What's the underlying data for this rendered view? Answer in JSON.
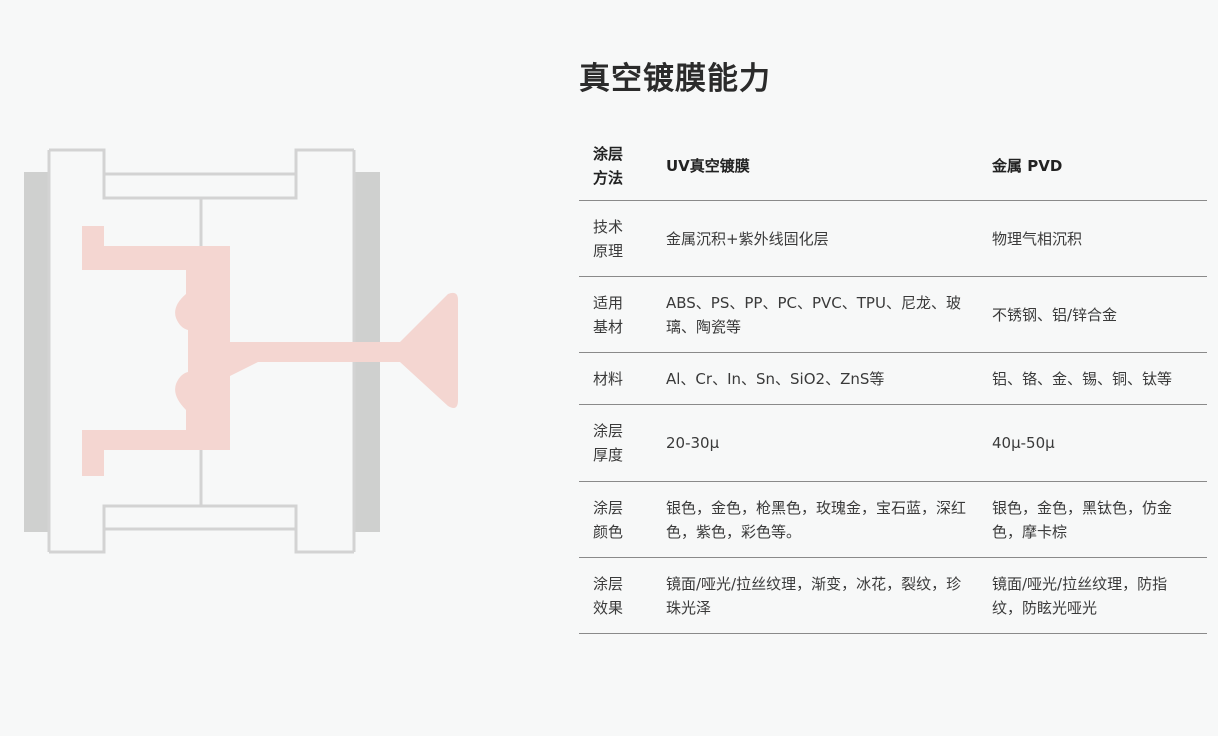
{
  "title": "真空镀膜能力",
  "table": {
    "headers": [
      "涂层方法",
      "UV真空镀膜",
      "金属 PVD"
    ],
    "rows": [
      {
        "label": "技术原理",
        "uv": "金属沉积+紫外线固化层",
        "pvd": "物理气相沉积"
      },
      {
        "label": "适用基材",
        "uv": "ABS、PS、PP、PC、PVC、TPU、尼龙、玻璃、陶瓷等",
        "pvd": "不锈钢、铝/锌合金"
      },
      {
        "label": "材料",
        "uv": "Al、Cr、In、Sn、SiO2、ZnS等",
        "pvd": "铝、铬、金、锡、铜、钛等"
      },
      {
        "label": "涂层厚度",
        "uv": "20-30μ",
        "pvd": "40μ-50μ"
      },
      {
        "label": "涂层颜色",
        "uv": "银色，金色，枪黑色，玫瑰金，宝石蓝，深红色，紫色，彩色等。",
        "pvd": "银色，金色，黑钛色，仿金色，摩卡棕"
      },
      {
        "label": "涂层效果",
        "uv": "镜面/哑光/拉丝纹理，渐变，冰花，裂纹，珍珠光泽",
        "pvd": "镜面/哑光/拉丝纹理，防指纹，防眩光哑光"
      }
    ]
  },
  "colors": {
    "background": "#f7f8f8",
    "mold_plate": "#cfd0cf",
    "mold_outline": "#d3d3d3",
    "part_fill": "#f4d6d1",
    "rule": "#8a8a8a"
  },
  "icons": [
    "injection-mold-diagram"
  ]
}
